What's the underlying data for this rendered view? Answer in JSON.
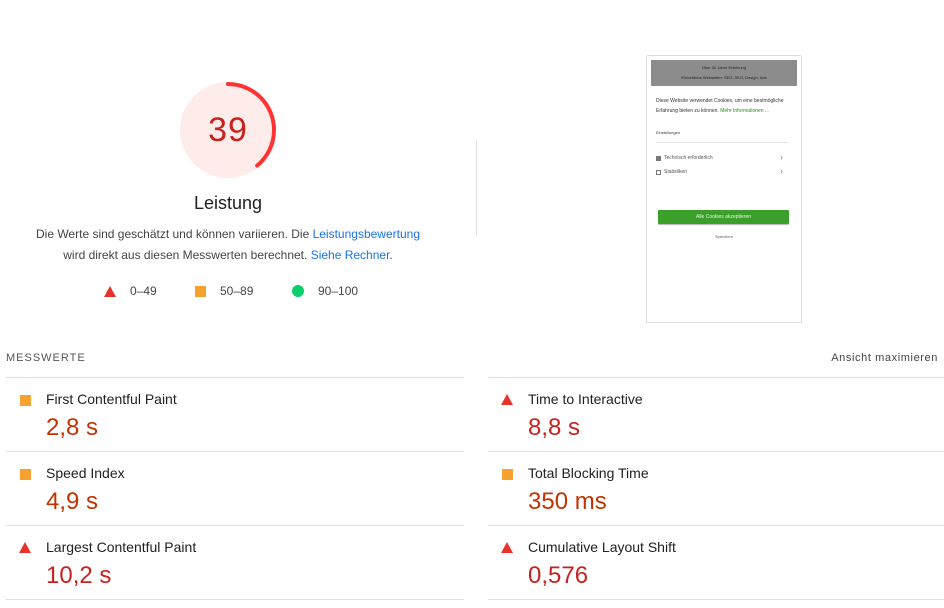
{
  "score": {
    "value": "39",
    "fraction": 0.39,
    "title": "Leistung",
    "desc_part1": "Die Werte sind geschätzt und können variieren. Die ",
    "desc_link1": "Leistungsbewertung",
    "desc_part2": "wird direkt aus diesen Messwerten berechnet. ",
    "desc_link2": "Siehe Rechner",
    "desc_end": ".",
    "colors": {
      "fail": "#c7221f",
      "fail_arc": "#ff3333",
      "fail_bg": "#fdecea",
      "link": "#1a73e8"
    }
  },
  "legend": {
    "fail": "0–49",
    "average": "50–89",
    "pass": "90–100"
  },
  "thumbnail": {
    "top_line1": "Über 30 Jahre Erfahrung",
    "top_line2": "Einheitliche Webseiten: SEO, SEO, Design, Ads",
    "text1": "Diese Website verwendet Cookies, um eine",
    "text2": "bestmögliche Erfahrung bieten zu können.",
    "link": "Mehr Informationen ...",
    "settings": "Einstellungen",
    "option1": "Technisch erforderlich",
    "option2": "Statistiken",
    "button": "Alle Cookies akzeptieren",
    "save": "Speichern"
  },
  "metrics": {
    "title": "MESSWERTE",
    "toggle": "Ansicht maximieren",
    "left": [
      {
        "label": "First Contentful Paint",
        "value": "2,8 s",
        "status": "average"
      },
      {
        "label": "Speed Index",
        "value": "4,9 s",
        "status": "average"
      },
      {
        "label": "Largest Contentful Paint",
        "value": "10,2 s",
        "status": "fail"
      }
    ],
    "right": [
      {
        "label": "Time to Interactive",
        "value": "8,8 s",
        "status": "fail"
      },
      {
        "label": "Total Blocking Time",
        "value": "350 ms",
        "status": "average"
      },
      {
        "label": "Cumulative Layout Shift",
        "value": "0,576",
        "status": "fail"
      }
    ]
  }
}
